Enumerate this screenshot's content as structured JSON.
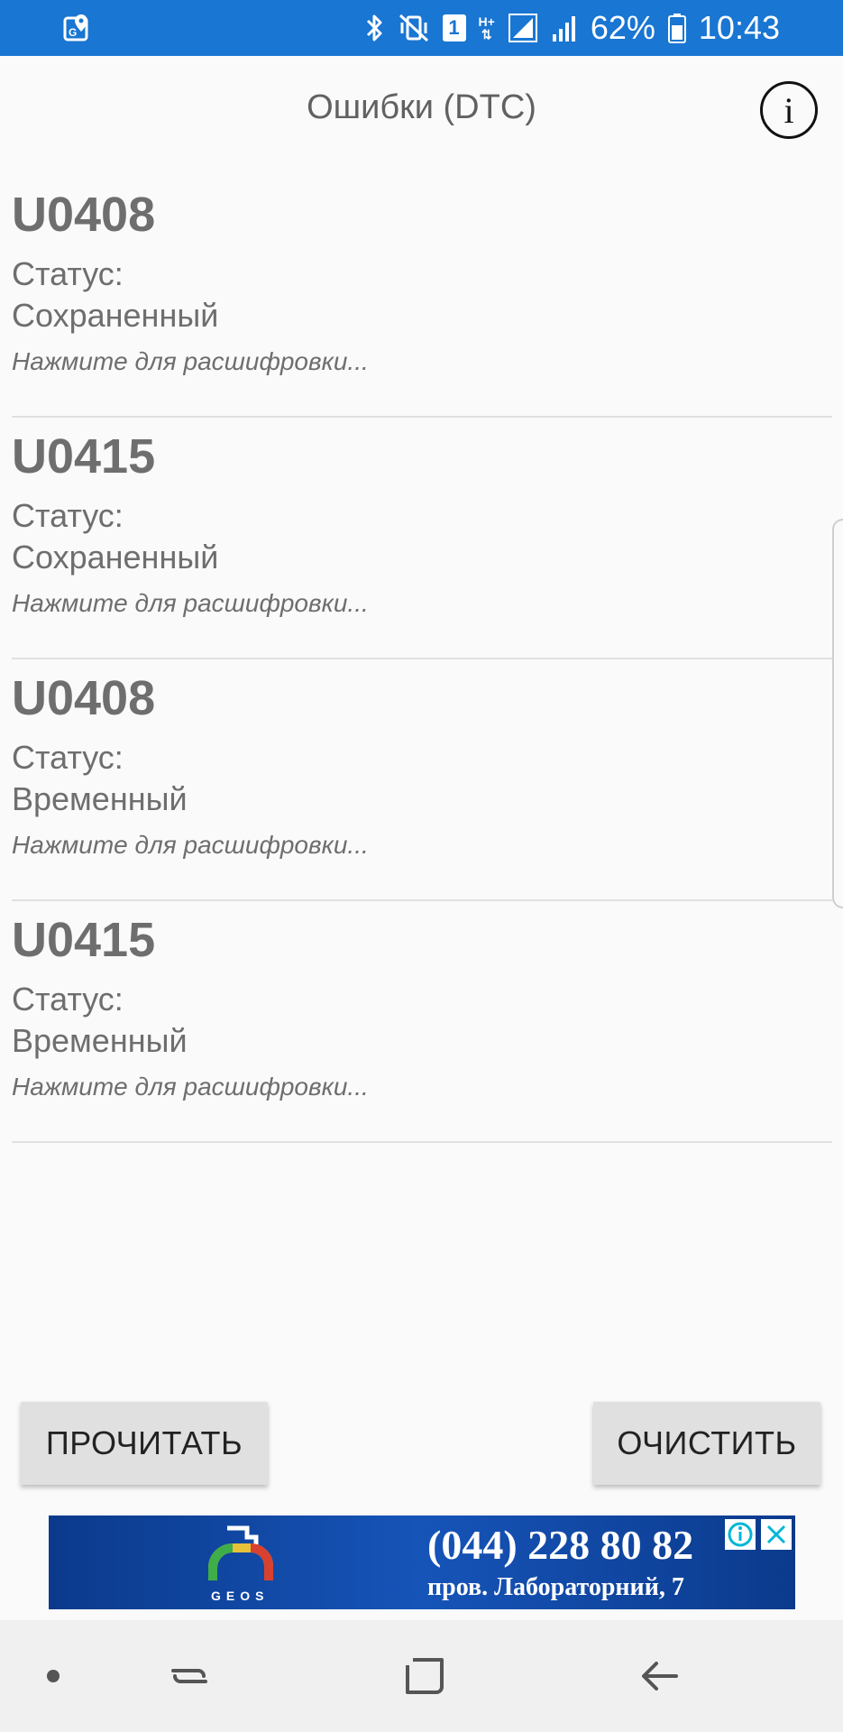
{
  "status_bar": {
    "battery_percent": "62%",
    "time": "10:43",
    "sim_badge": "1",
    "network_label": "H+",
    "icons": [
      "maps-location-icon",
      "bluetooth-icon",
      "vibrate-mute-icon",
      "sim-icon",
      "data-arrows-icon",
      "signal-icon",
      "signal-icon-2",
      "battery-icon"
    ]
  },
  "header": {
    "title": "Ошибки (DTC)",
    "info_icon": "info-icon",
    "info_glyph": "i"
  },
  "dtc_items": [
    {
      "code": "U0408",
      "status_label": "Статус:",
      "status_value": "Сохраненный",
      "hint": "Нажмите для расшифровки..."
    },
    {
      "code": "U0415",
      "status_label": "Статус:",
      "status_value": "Сохраненный",
      "hint": "Нажмите для расшифровки..."
    },
    {
      "code": "U0408",
      "status_label": "Статус:",
      "status_value": "Временный",
      "hint": "Нажмите для расшифровки..."
    },
    {
      "code": "U0415",
      "status_label": "Статус:",
      "status_value": "Временный",
      "hint": "Нажмите для расшифровки..."
    }
  ],
  "buttons": {
    "read": "ПРОЧИТАТЬ",
    "clear": "ОЧИСТИТЬ"
  },
  "ad": {
    "phone": "(044) 228 80 82",
    "address": "пров. Лабораторний, 7",
    "logo_text": "GEOS",
    "icons": [
      "ad-choices-icon",
      "close-icon"
    ]
  },
  "nav_bar": {
    "icons": [
      "dot-icon",
      "recents-icon",
      "home-icon",
      "back-icon"
    ]
  },
  "colors": {
    "status_bar": "#1976d2",
    "background": "#fafafa",
    "text_gray": "#6e6e6e",
    "button_bg": "#e0e0e0",
    "ad_bg": "#1654b8",
    "ad_choices": "#00b6d6"
  }
}
